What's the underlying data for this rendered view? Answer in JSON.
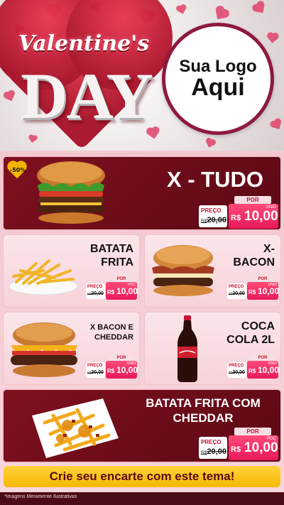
{
  "header": {
    "title_script": "Valentine's",
    "title_big": "DAY",
    "logo_line1": "Sua Logo",
    "logo_line2": "Aqui"
  },
  "colors": {
    "brand_dark": "#7f1020",
    "accent_pink": "#e8185a",
    "cta_yellow": "#f6b800"
  },
  "discount_badge": "-50%",
  "items": [
    {
      "name": "X - TUDO",
      "por": "POR",
      "preco": "PREÇO",
      "old": "20,00",
      "old_prefix": "R$",
      "cur": "R$",
      "price": "10,00",
      "unit": "UNID",
      "icon": "burger-icon"
    },
    {
      "name": "BATATA FRITA",
      "por": "POR",
      "preco": "PREÇO",
      "old": "20,00",
      "old_prefix": "R$",
      "cur": "R$",
      "price": "10,00",
      "unit": "POÇ",
      "icon": "fries-icon"
    },
    {
      "name": "X- BACON",
      "por": "POR",
      "preco": "PREÇO",
      "old": "20,00",
      "old_prefix": "R$",
      "cur": "R$",
      "price": "10,00",
      "unit": "UNID",
      "icon": "bacon-burger-icon"
    },
    {
      "name": "X BACON E CHEDDAR",
      "por": "POR",
      "preco": "PREÇO",
      "old": "20,00",
      "old_prefix": "R$",
      "cur": "R$",
      "price": "10,00",
      "unit": "UNID",
      "icon": "cheddar-burger-icon"
    },
    {
      "name": "COCA COLA 2L",
      "por": "POR",
      "preco": "PREÇO",
      "old": "20,00",
      "old_prefix": "R$",
      "cur": "R$",
      "price": "10,00",
      "unit": "UNID",
      "icon": "soda-bottle-icon"
    },
    {
      "name": "BATATA FRITA COM CHEDDAR",
      "por": "POR",
      "preco": "PREÇO",
      "old": "20,00",
      "old_prefix": "R$",
      "cur": "R$",
      "price": "10,00",
      "unit": "POÇ",
      "icon": "cheddar-fries-icon"
    }
  ],
  "cta": "Crie seu encarte com este tema!",
  "footer_note": "*Imagens Meramente Ilustrativas"
}
